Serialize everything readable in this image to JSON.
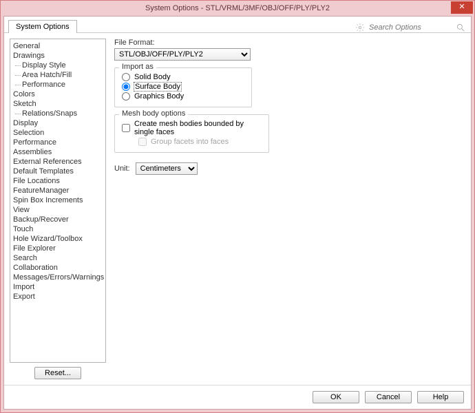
{
  "titlebar": {
    "text": "System Options - STL/VRML/3MF/OBJ/OFF/PLY/PLY2"
  },
  "tab": {
    "label": "System Options"
  },
  "search": {
    "placeholder": "Search Options"
  },
  "sidebar": {
    "items": [
      {
        "label": "General",
        "child": false
      },
      {
        "label": "Drawings",
        "child": false
      },
      {
        "label": "Display Style",
        "child": true
      },
      {
        "label": "Area Hatch/Fill",
        "child": true
      },
      {
        "label": "Performance",
        "child": true
      },
      {
        "label": "Colors",
        "child": false
      },
      {
        "label": "Sketch",
        "child": false
      },
      {
        "label": "Relations/Snaps",
        "child": true
      },
      {
        "label": "Display",
        "child": false
      },
      {
        "label": "Selection",
        "child": false
      },
      {
        "label": "Performance",
        "child": false
      },
      {
        "label": "Assemblies",
        "child": false
      },
      {
        "label": "External References",
        "child": false
      },
      {
        "label": "Default Templates",
        "child": false
      },
      {
        "label": "File Locations",
        "child": false
      },
      {
        "label": "FeatureManager",
        "child": false
      },
      {
        "label": "Spin Box Increments",
        "child": false
      },
      {
        "label": "View",
        "child": false
      },
      {
        "label": "Backup/Recover",
        "child": false
      },
      {
        "label": "Touch",
        "child": false
      },
      {
        "label": "Hole Wizard/Toolbox",
        "child": false
      },
      {
        "label": "File Explorer",
        "child": false
      },
      {
        "label": "Search",
        "child": false
      },
      {
        "label": "Collaboration",
        "child": false
      },
      {
        "label": "Messages/Errors/Warnings",
        "child": false
      },
      {
        "label": "Import",
        "child": false
      },
      {
        "label": "Export",
        "child": false
      }
    ],
    "reset": "Reset..."
  },
  "content": {
    "file_format_label": "File Format:",
    "file_format_value": "STL/OBJ/OFF/PLY/PLY2",
    "import_as": {
      "legend": "Import as",
      "opts": [
        "Solid Body",
        "Surface Body",
        "Graphics Body"
      ],
      "selected": 1
    },
    "mesh": {
      "legend": "Mesh body options",
      "chk1": "Create mesh bodies bounded by single faces",
      "chk2": "Group facets into faces"
    },
    "unit_label": "Unit:",
    "unit_value": "Centimeters"
  },
  "footer": {
    "ok": "OK",
    "cancel": "Cancel",
    "help": "Help"
  }
}
